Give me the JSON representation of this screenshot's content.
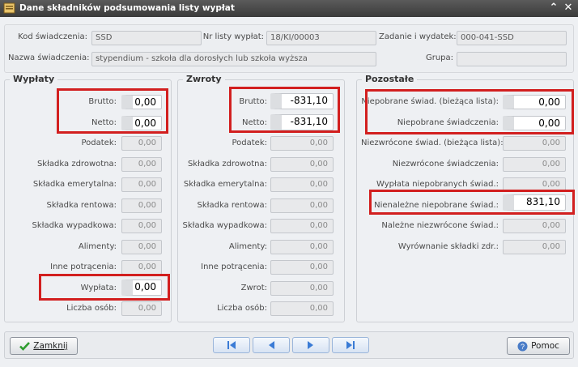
{
  "window": {
    "title": "Dane składników podsumowania listy wypłat"
  },
  "header": {
    "kod_label": "Kod świadczenia:",
    "kod_value": "SSD",
    "nr_label": "Nr listy wypłat:",
    "nr_value": "18/KI/00003",
    "zadanie_label": "Zadanie i wydatek:",
    "zadanie_value": "000-041-SSD",
    "nazwa_label": "Nazwa świadczenia:",
    "nazwa_value": "stypendium - szkoła dla dorosłych lub szkoła wyższa",
    "grupa_label": "Grupa:",
    "grupa_value": ""
  },
  "wyplaty": {
    "title": "Wypłaty",
    "rows": [
      {
        "label": "Brutto:",
        "value": "0,00"
      },
      {
        "label": "Netto:",
        "value": "0,00"
      },
      {
        "label": "Podatek:",
        "value": "0,00"
      },
      {
        "label": "Składka zdrowotna:",
        "value": "0,00"
      },
      {
        "label": "Składka emerytalna:",
        "value": "0,00"
      },
      {
        "label": "Składka rentowa:",
        "value": "0,00"
      },
      {
        "label": "Składka wypadkowa:",
        "value": "0,00"
      },
      {
        "label": "Alimenty:",
        "value": "0,00"
      },
      {
        "label": "Inne potrącenia:",
        "value": "0,00"
      },
      {
        "label": "Wypłata:",
        "value": "0,00"
      },
      {
        "label": "Liczba osób:",
        "value": "0,00"
      }
    ]
  },
  "zwroty": {
    "title": "Zwroty",
    "rows": [
      {
        "label": "Brutto:",
        "value": "-831,10"
      },
      {
        "label": "Netto:",
        "value": "-831,10"
      },
      {
        "label": "Podatek:",
        "value": "0,00"
      },
      {
        "label": "Składka zdrowotna:",
        "value": "0,00"
      },
      {
        "label": "Składka emerytalna:",
        "value": "0,00"
      },
      {
        "label": "Składka rentowa:",
        "value": "0,00"
      },
      {
        "label": "Składka wypadkowa:",
        "value": "0,00"
      },
      {
        "label": "Alimenty:",
        "value": "0,00"
      },
      {
        "label": "Inne potrącenia:",
        "value": "0,00"
      },
      {
        "label": "Zwrot:",
        "value": "0,00"
      },
      {
        "label": "Liczba osób:",
        "value": "0,00"
      }
    ]
  },
  "pozostale": {
    "title": "Pozostałe",
    "rows": [
      {
        "label": "Niepobrane świad. (bieżąca lista):",
        "value": "0,00"
      },
      {
        "label": "Niepobrane świadczenia:",
        "value": "0,00"
      },
      {
        "label": "Niezwrócone świad. (bieżąca lista):",
        "value": "0,00"
      },
      {
        "label": "Niezwrócone świadczenia:",
        "value": "0,00"
      },
      {
        "label": "Wypłata niepobranych świad.:",
        "value": "0,00"
      },
      {
        "label": "Nienależne niepobrane świad.:",
        "value": "831,10"
      },
      {
        "label": "Należne niezwrócone świad.:",
        "value": "0,00"
      },
      {
        "label": "Wyrównanie składki zdr.:",
        "value": "0,00"
      }
    ]
  },
  "buttons": {
    "close": "Zamknij",
    "help": "Pomoc"
  },
  "colors": {
    "highlight": "#d21f1f",
    "titlebar": "#3a3a3a"
  }
}
